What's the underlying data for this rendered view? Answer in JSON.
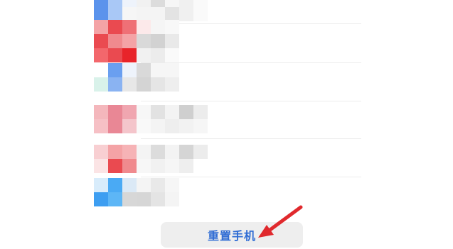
{
  "reset_button": {
    "label": "重置手机"
  },
  "arrow": {
    "color": "#e0292d"
  },
  "mosaic_palette": {
    "blue": "#5b93ec",
    "light_blue": "#a9c8f6",
    "red": "#ea4a50",
    "pink": "#f4a3a6",
    "rose": "#e98795",
    "light_rose": "#f8cfd2",
    "sky": "#4aaaf4",
    "mint": "#d9f2ea",
    "gray": "#d8d8d8",
    "light_gray": "#ececec",
    "lighter_gray": "#f4f4f4"
  },
  "settings_items": [
    {
      "name": "item-1",
      "obscured": true
    },
    {
      "name": "item-2",
      "obscured": true
    },
    {
      "name": "item-3",
      "obscured": true
    },
    {
      "name": "item-4",
      "obscured": true
    },
    {
      "name": "item-5",
      "obscured": true
    },
    {
      "name": "item-6",
      "obscured": true
    }
  ]
}
